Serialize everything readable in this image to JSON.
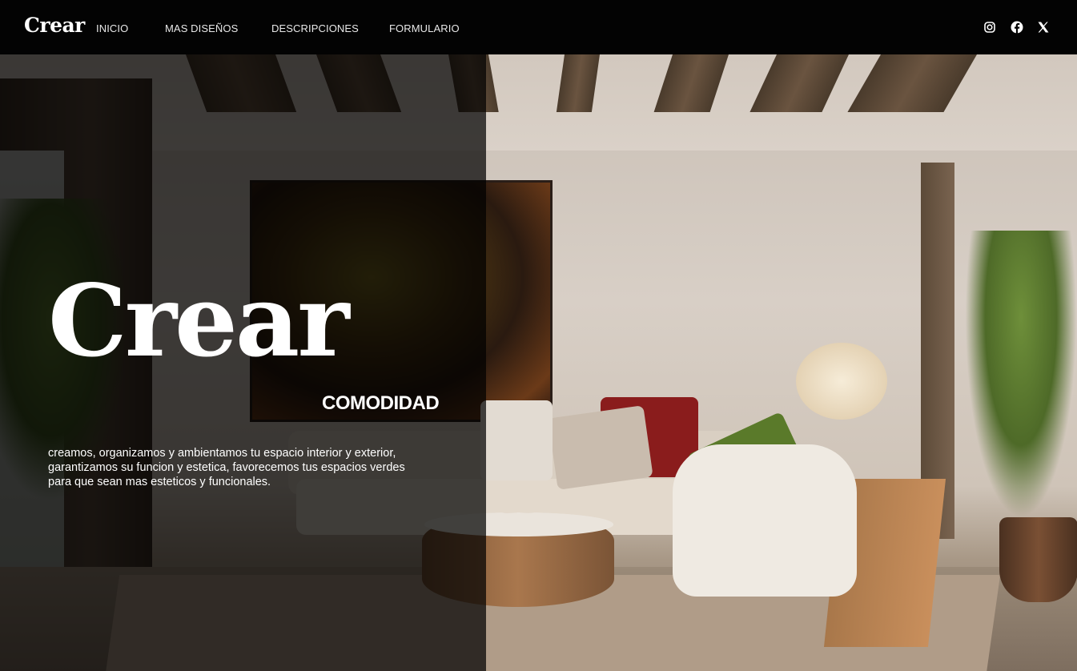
{
  "nav": {
    "brand": "Crear",
    "links": [
      {
        "label": "INICIO"
      },
      {
        "label": "MAS DISEÑOS"
      },
      {
        "label": "DESCRIPCIONES"
      },
      {
        "label": "FORMULARIO"
      }
    ],
    "social": [
      {
        "icon": "instagram-icon"
      },
      {
        "icon": "facebook-icon"
      },
      {
        "icon": "x-twitter-icon"
      }
    ]
  },
  "hero": {
    "title": "Crear",
    "subtitle": "COMODIDAD",
    "description_lines": [
      "creamos, organizamos y ambientamos tu espacio interior y exterior,",
      "garantizamos su funcion y estetica, favorecemos tus espacios verdes",
      "para que sean mas esteticos y funcionales."
    ],
    "image_alt": "living-room-photo"
  },
  "colors": {
    "navbar_bg": "#030303",
    "text": "#ffffff",
    "overlay": "rgba(0,0,0,0.72)"
  }
}
